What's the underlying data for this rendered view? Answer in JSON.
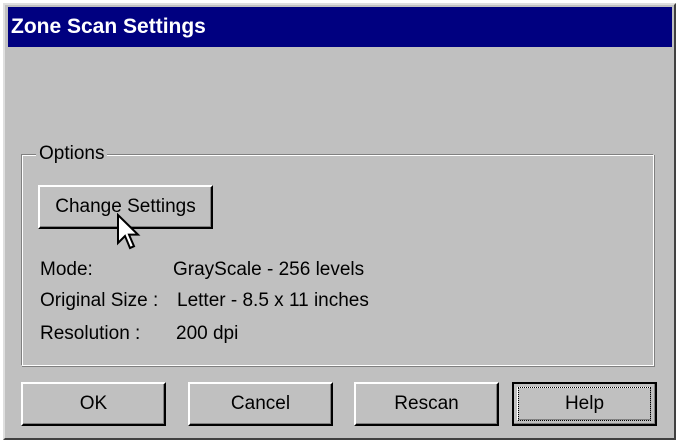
{
  "window": {
    "title": "Zone Scan Settings"
  },
  "options": {
    "group_label": "Options",
    "change_settings_label": "Change Settings",
    "mode_label": "Mode:",
    "mode_value": "GrayScale - 256 levels",
    "size_label": "Original Size :",
    "size_value": "Letter - 8.5 x 11 inches",
    "resolution_label": "Resolution :",
    "resolution_value": "200 dpi"
  },
  "buttons": {
    "ok_label": "OK",
    "cancel_label": "Cancel",
    "rescan_label": "Rescan",
    "help_label": "Help"
  },
  "icons": {
    "cursor": "mouse-pointer-icon"
  },
  "colors": {
    "titlebar": "#000080",
    "face": "#c0c0c0"
  }
}
